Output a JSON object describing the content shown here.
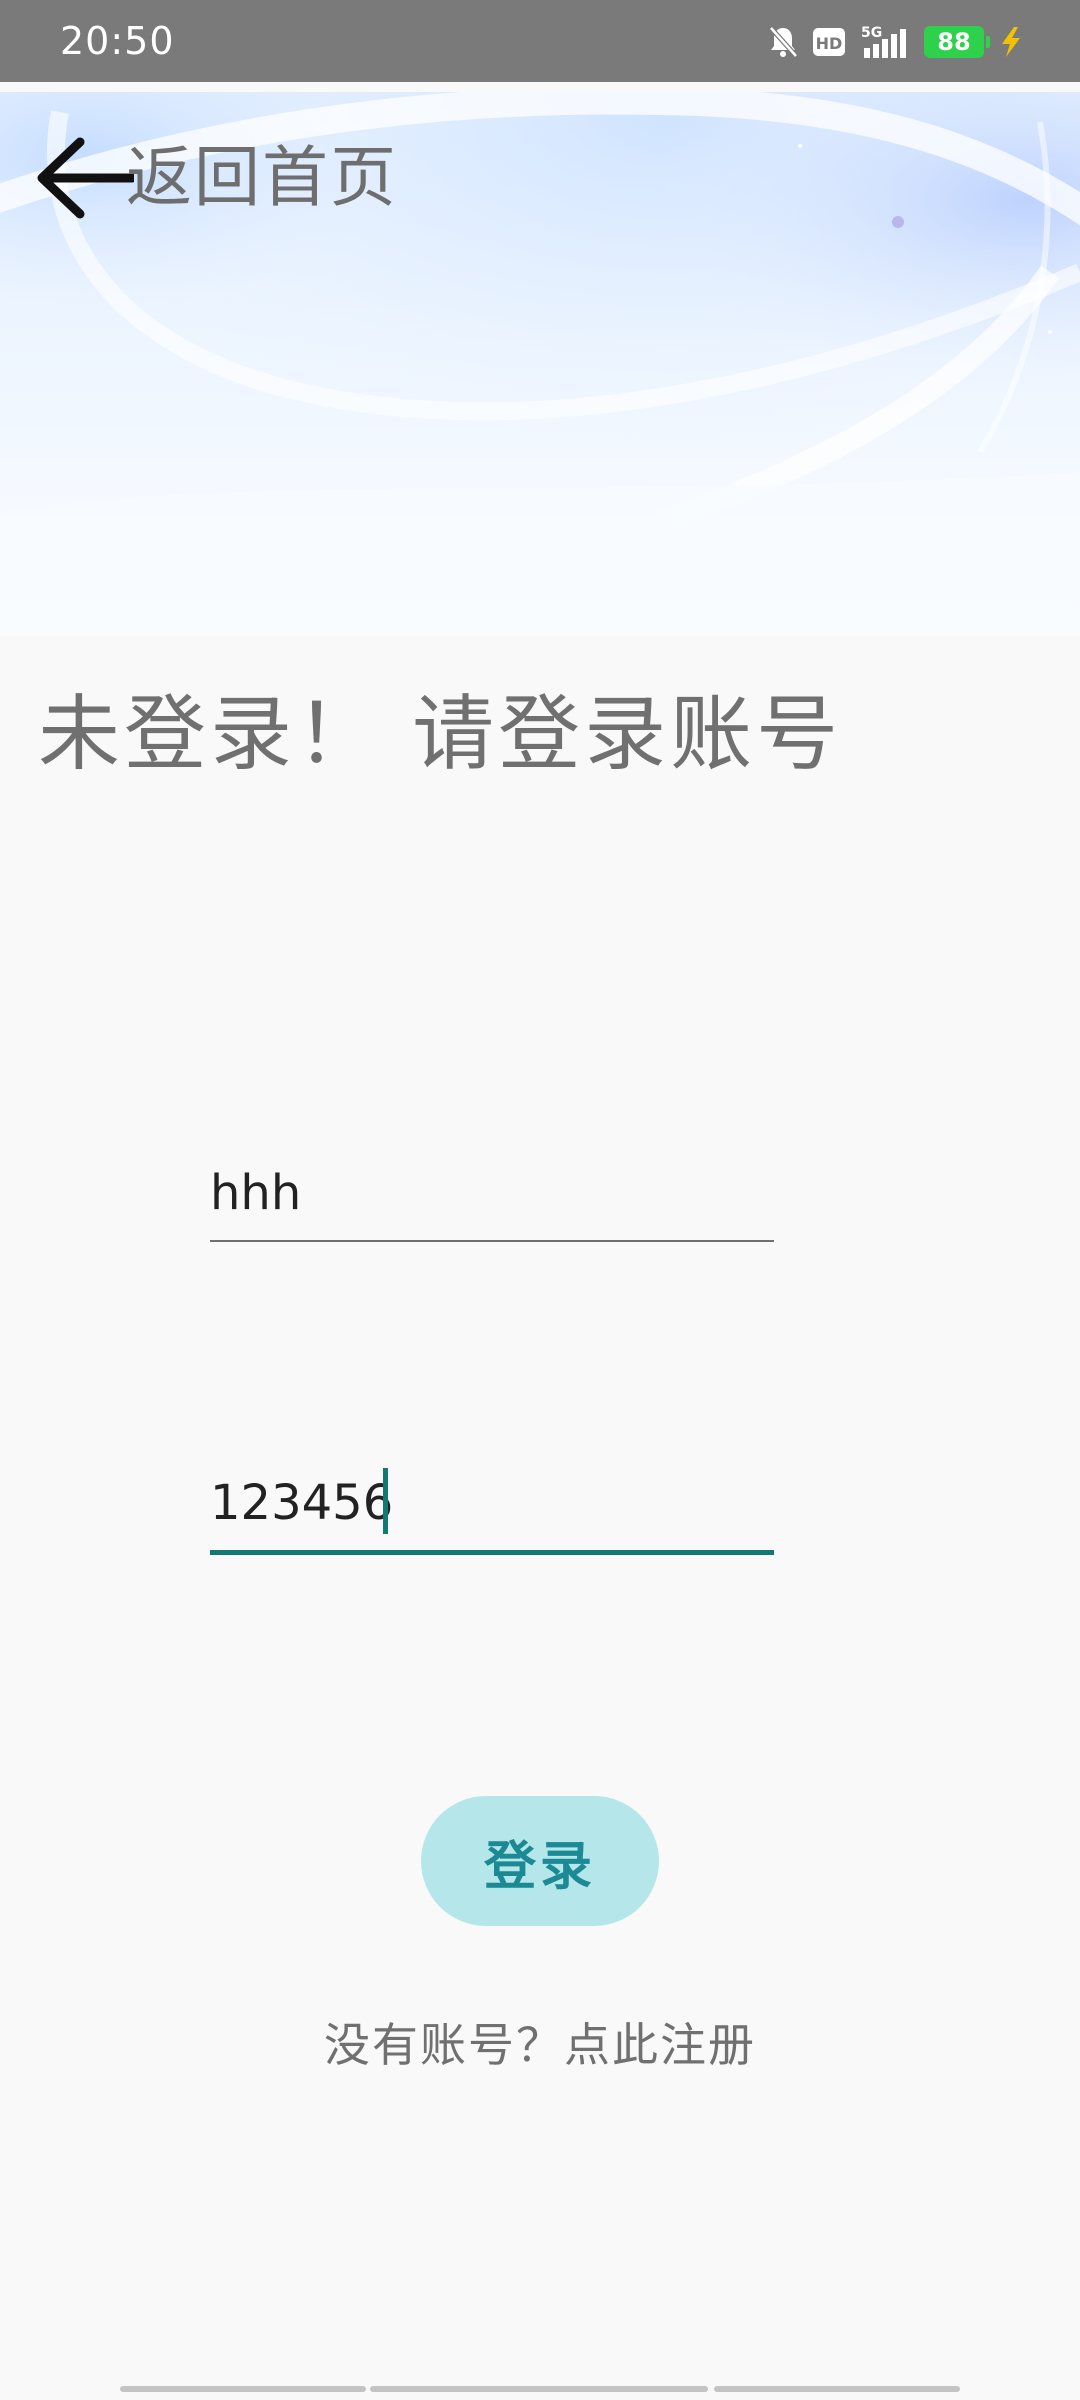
{
  "status_bar": {
    "time": "20:50",
    "network_label": "5G",
    "hd_label": "HD",
    "battery_level": "88",
    "icons": [
      "mute-bell-icon",
      "hd-icon",
      "signal-5g-icon",
      "battery-icon",
      "charging-bolt-icon"
    ]
  },
  "header": {
    "back_label": "返回首页",
    "back_icon": "arrow-left-icon"
  },
  "login": {
    "status_text": "未登录！ 请登录账号",
    "username_value": "hhh",
    "password_value": "123456",
    "submit_label": "登录",
    "register_text": "没有账号？点此注册"
  },
  "colors": {
    "accent": "#127a72",
    "button_bg": "#b4e6ea",
    "button_text": "#1b8a94",
    "status_bar_bg": "#7a7a7a",
    "battery": "#2ed14b"
  }
}
